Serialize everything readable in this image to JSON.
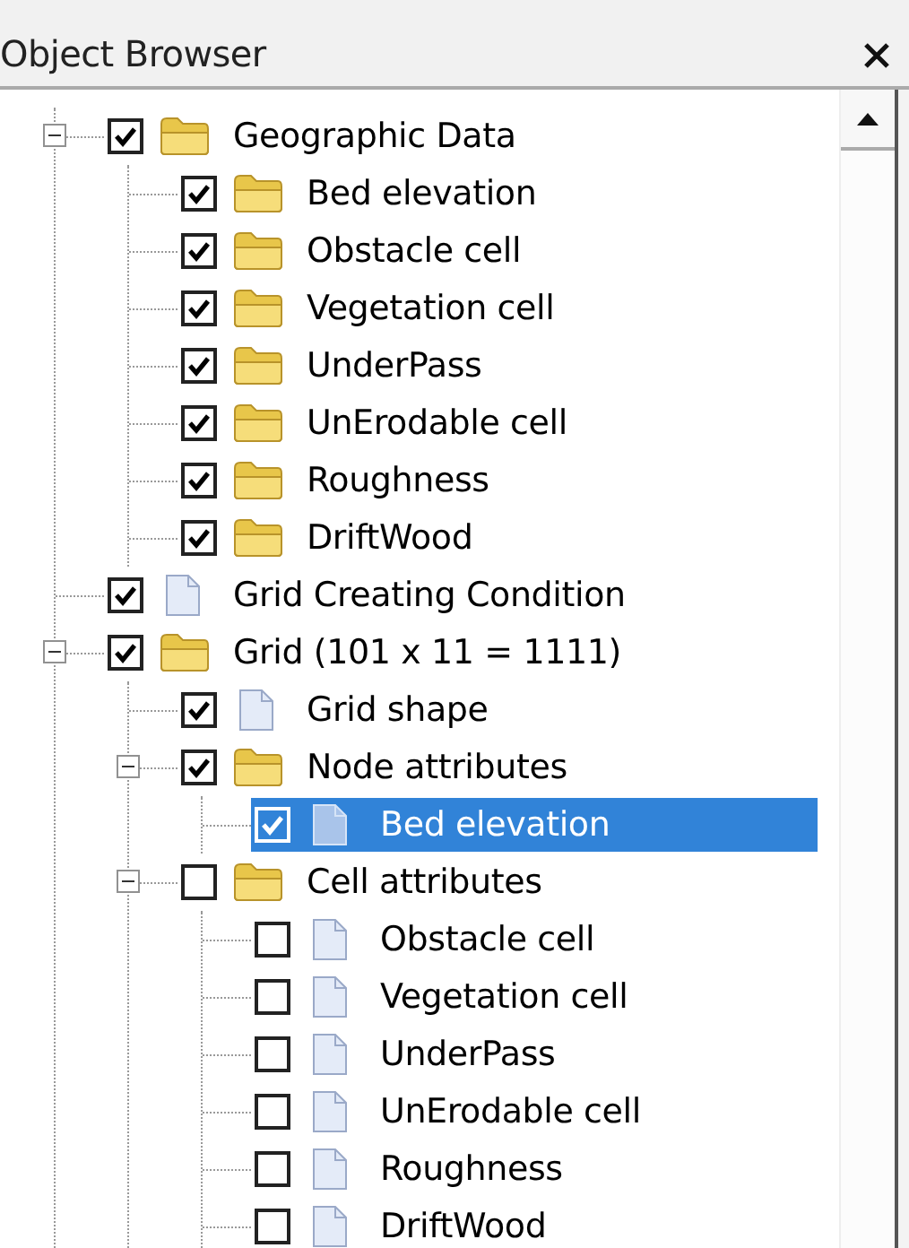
{
  "panel": {
    "title": "Object Browser"
  },
  "tree": [
    {
      "label": "Geographic Data",
      "kind": "folder",
      "checked": true,
      "selected": false,
      "expanded": true,
      "children": [
        {
          "label": "Bed elevation",
          "kind": "folder",
          "checked": true,
          "selected": false
        },
        {
          "label": "Obstacle cell",
          "kind": "folder",
          "checked": true,
          "selected": false
        },
        {
          "label": "Vegetation cell",
          "kind": "folder",
          "checked": true,
          "selected": false
        },
        {
          "label": "UnderPass",
          "kind": "folder",
          "checked": true,
          "selected": false
        },
        {
          "label": "UnErodable cell",
          "kind": "folder",
          "checked": true,
          "selected": false
        },
        {
          "label": "Roughness",
          "kind": "folder",
          "checked": true,
          "selected": false
        },
        {
          "label": "DriftWood",
          "kind": "folder",
          "checked": true,
          "selected": false
        }
      ]
    },
    {
      "label": "Grid Creating Condition",
      "kind": "file",
      "checked": true,
      "selected": false
    },
    {
      "label": "Grid (101 x 11 = 1111)",
      "kind": "folder",
      "checked": true,
      "selected": false,
      "expanded": true,
      "children": [
        {
          "label": "Grid shape",
          "kind": "file",
          "checked": true,
          "selected": false
        },
        {
          "label": "Node attributes",
          "kind": "folder",
          "checked": true,
          "selected": false,
          "expanded": true,
          "children": [
            {
              "label": "Bed elevation",
              "kind": "file",
              "checked": true,
              "selected": true
            }
          ]
        },
        {
          "label": "Cell attributes",
          "kind": "folder",
          "checked": false,
          "selected": false,
          "expanded": true,
          "children": [
            {
              "label": "Obstacle cell",
              "kind": "file",
              "checked": false,
              "selected": false
            },
            {
              "label": "Vegetation cell",
              "kind": "file",
              "checked": false,
              "selected": false
            },
            {
              "label": "UnderPass",
              "kind": "file",
              "checked": false,
              "selected": false
            },
            {
              "label": "UnErodable cell",
              "kind": "file",
              "checked": false,
              "selected": false
            },
            {
              "label": "Roughness",
              "kind": "file",
              "checked": false,
              "selected": false
            },
            {
              "label": "DriftWood",
              "kind": "file",
              "checked": false,
              "selected": false
            }
          ]
        }
      ]
    }
  ]
}
